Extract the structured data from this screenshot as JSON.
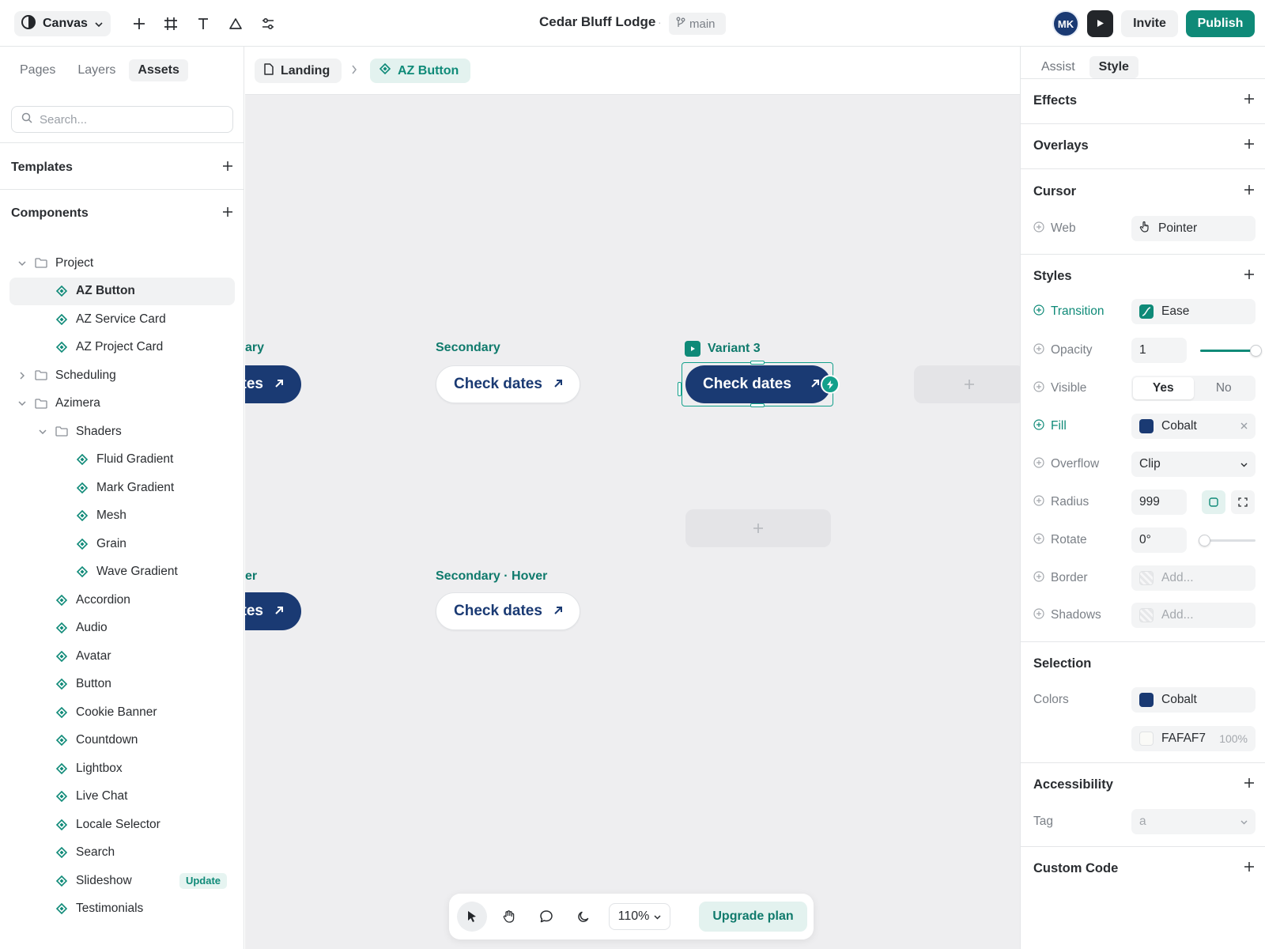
{
  "app": {
    "mode_label": "Canvas",
    "project_title": "Cedar Bluff Lodge",
    "separator": "·",
    "branch": "main",
    "avatar_initials": "MK",
    "invite_label": "Invite",
    "publish_label": "Publish",
    "accent_color": "#0f8a78",
    "brand_color": "#1a3a73"
  },
  "left_panel": {
    "tabs": [
      "Pages",
      "Layers",
      "Assets"
    ],
    "active_tab": "Assets",
    "search_placeholder": "Search...",
    "templates_label": "Templates",
    "components_label": "Components",
    "tree": [
      {
        "label": "Project",
        "type": "folder",
        "expanded": true
      },
      {
        "label": "AZ Button",
        "type": "component",
        "selected": true
      },
      {
        "label": "AZ Service Card",
        "type": "component"
      },
      {
        "label": "AZ Project Card",
        "type": "component"
      },
      {
        "label": "Scheduling",
        "type": "folder",
        "expanded": false
      },
      {
        "label": "Azimera",
        "type": "folder",
        "expanded": true
      },
      {
        "label": "Shaders",
        "type": "folder",
        "expanded": true
      },
      {
        "label": "Fluid Gradient",
        "type": "component"
      },
      {
        "label": "Mark Gradient",
        "type": "component"
      },
      {
        "label": "Mesh",
        "type": "component"
      },
      {
        "label": "Grain",
        "type": "component"
      },
      {
        "label": "Wave Gradient",
        "type": "component"
      },
      {
        "label": "Accordion",
        "type": "component"
      },
      {
        "label": "Audio",
        "type": "component"
      },
      {
        "label": "Avatar",
        "type": "component"
      },
      {
        "label": "Button",
        "type": "component"
      },
      {
        "label": "Cookie Banner",
        "type": "component"
      },
      {
        "label": "Countdown",
        "type": "component"
      },
      {
        "label": "Lightbox",
        "type": "component"
      },
      {
        "label": "Live Chat",
        "type": "component"
      },
      {
        "label": "Locale Selector",
        "type": "component"
      },
      {
        "label": "Search",
        "type": "component"
      },
      {
        "label": "Slideshow",
        "type": "component",
        "badge": "Update"
      },
      {
        "label": "Testimonials",
        "type": "component"
      }
    ]
  },
  "canvas": {
    "breadcrumb_page": "Landing",
    "breadcrumb_component": "AZ Button",
    "variants": {
      "primary_label_partial": "ary",
      "secondary_label": "Secondary",
      "variant3_label": "Variant 3",
      "primary_hover_label_partial": "er",
      "secondary_hover_label": "Secondary · Hover"
    },
    "button_text": "Check dates",
    "button_text_partial": "ates",
    "zoom": "110%",
    "upgrade_label": "Upgrade plan"
  },
  "right_panel": {
    "tabs": [
      "Assist",
      "Style"
    ],
    "active_tab": "Style",
    "sections": {
      "effects": "Effects",
      "overlays": "Overlays",
      "cursor": "Cursor",
      "styles": "Styles",
      "selection": "Selection",
      "accessibility": "Accessibility",
      "custom_code": "Custom Code"
    },
    "cursor": {
      "label": "Web",
      "value": "Pointer"
    },
    "styles": {
      "transition": {
        "label": "Transition",
        "value": "Ease"
      },
      "opacity": {
        "label": "Opacity",
        "value": "1",
        "level": 1.0
      },
      "visible": {
        "label": "Visible",
        "options": [
          "Yes",
          "No"
        ],
        "selected": "Yes"
      },
      "fill": {
        "label": "Fill",
        "value": "Cobalt",
        "color": "#1a3a73"
      },
      "overflow": {
        "label": "Overflow",
        "value": "Clip"
      },
      "radius": {
        "label": "Radius",
        "value": "999"
      },
      "rotate": {
        "label": "Rotate",
        "value": "0°",
        "level": 0
      },
      "border": {
        "label": "Border",
        "placeholder": "Add..."
      },
      "shadows": {
        "label": "Shadows",
        "placeholder": "Add..."
      }
    },
    "selection": {
      "colors_label": "Colors",
      "colors": [
        {
          "name": "Cobalt",
          "hex": "#1a3a73"
        },
        {
          "name": "FAFAF7",
          "hex": "#fafaf7",
          "opacity": "100%"
        }
      ]
    },
    "accessibility": {
      "tag_label": "Tag",
      "tag_value": "a"
    }
  }
}
